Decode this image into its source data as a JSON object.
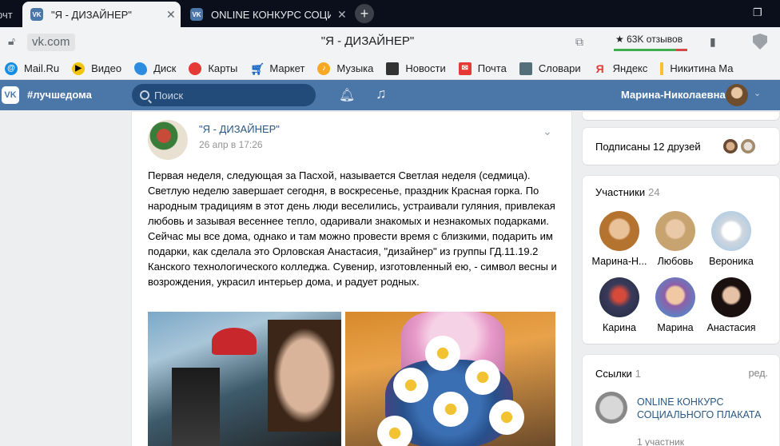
{
  "browser": {
    "tabs": [
      {
        "title": "рчт"
      },
      {
        "title": "\"Я - ДИЗАЙНЕР\"",
        "active": true
      },
      {
        "title": "ONLINE КОНКУРС СОЦИА"
      }
    ],
    "new_tab": "+",
    "url": "vk.com",
    "page_title": "\"Я - ДИЗАЙНЕР\"",
    "rating_text": "★ 63K отзывов",
    "rating_fraction": 0.85,
    "bookmarks": [
      "Mail.Ru",
      "Видео",
      "Диск",
      "Карты",
      "Маркет",
      "Музыка",
      "Новости",
      "Почта",
      "Словари",
      "Яндекс",
      "Никитина Ма"
    ]
  },
  "header": {
    "logo": "VK",
    "hashtag": "#лучшедома",
    "search_placeholder": "Поиск",
    "username": "Марина-Николаевна"
  },
  "post": {
    "author": "\"Я - ДИЗАЙНЕР\"",
    "date": "26 апр в 17:26",
    "paragraphs": [
      "Первая неделя, следующая за Пасхой, называется Светлая неделя (седмица). Светлую неделю завершает сегодня, в воскресенье, праздник Красная горка. По народным традициям в этот день люди веселились, устраивали гуляния, привлекая любовь и зазывая весеннее тепло, одаривали знакомых и незнакомых подарками.",
      "Сейчас мы все дома, однако и там можно провести время с близкими, подарить им подарки, как сделала это Орловская Анастасия, \"дизайнер\" из группы ГД.11.19.2 Канского технологического колледжа. Сувенир, изготовленный ею, - символ весны и возрождения, украсил интерьер дома, и радует родных."
    ]
  },
  "sidebar": {
    "friends_text": "Подписаны 12 друзей",
    "members_title": "Участники",
    "members_count": "24",
    "members": [
      {
        "name": "Марина-Н..."
      },
      {
        "name": "Любовь"
      },
      {
        "name": "Вероника"
      },
      {
        "name": "Карина"
      },
      {
        "name": "Марина"
      },
      {
        "name": "Анастасия"
      }
    ],
    "links_title": "Ссылки",
    "links_count": "1",
    "links_edit": "ред.",
    "link_name": "ONLINE КОНКУРС СОЦИАЛЬНОГО ПЛАКАТА",
    "link_sub": "1 участник"
  },
  "colors": {
    "vk_blue": "#4a76a8",
    "link": "#2a5885",
    "muted": "#939393"
  }
}
